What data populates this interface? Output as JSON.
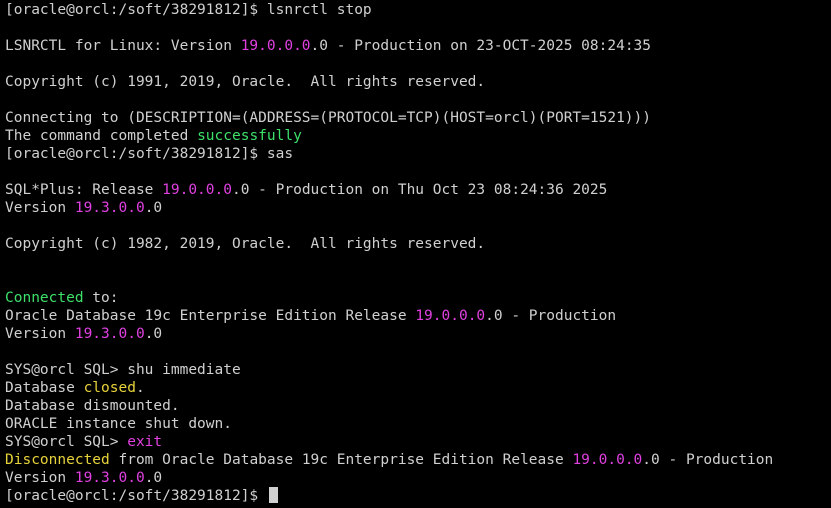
{
  "colors": {
    "background": "#000000",
    "text": "#d0d0d0",
    "version_magenta": "#e040e0",
    "success_green": "#3ee06a",
    "status_yellow": "#e6d23a"
  },
  "lines": [
    {
      "name": "prompt-line",
      "segments": [
        {
          "text": "[oracle@orcl:/soft/38291812]$ lsnrctl stop"
        }
      ]
    },
    {
      "name": "blank-line",
      "segments": []
    },
    {
      "name": "output-line",
      "segments": [
        {
          "text": "LSNRCTL for Linux: Version "
        },
        {
          "text": "19.0.0.0",
          "color": "magenta"
        },
        {
          "text": ".0 - Production on 23-OCT-2025 08:24:35"
        }
      ]
    },
    {
      "name": "blank-line",
      "segments": []
    },
    {
      "name": "output-line",
      "segments": [
        {
          "text": "Copyright (c) 1991, 2019, Oracle.  All rights reserved."
        }
      ]
    },
    {
      "name": "blank-line",
      "segments": []
    },
    {
      "name": "output-line",
      "segments": [
        {
          "text": "Connecting to (DESCRIPTION=(ADDRESS=(PROTOCOL=TCP)(HOST=orcl)(PORT=1521)))"
        }
      ]
    },
    {
      "name": "output-line",
      "segments": [
        {
          "text": "The command completed "
        },
        {
          "text": "successfully",
          "color": "green"
        }
      ]
    },
    {
      "name": "prompt-line",
      "segments": [
        {
          "text": "[oracle@orcl:/soft/38291812]$ sas"
        }
      ]
    },
    {
      "name": "blank-line",
      "segments": []
    },
    {
      "name": "output-line",
      "segments": [
        {
          "text": "SQL*Plus: Release "
        },
        {
          "text": "19.0.0.0",
          "color": "magenta"
        },
        {
          "text": ".0 - Production on Thu Oct 23 08:24:36 2025"
        }
      ]
    },
    {
      "name": "output-line",
      "segments": [
        {
          "text": "Version "
        },
        {
          "text": "19.3.0.0",
          "color": "magenta"
        },
        {
          "text": ".0"
        }
      ]
    },
    {
      "name": "blank-line",
      "segments": []
    },
    {
      "name": "output-line",
      "segments": [
        {
          "text": "Copyright (c) 1982, 2019, Oracle.  All rights reserved."
        }
      ]
    },
    {
      "name": "blank-line",
      "segments": []
    },
    {
      "name": "blank-line",
      "segments": []
    },
    {
      "name": "output-line",
      "segments": [
        {
          "text": "Connected",
          "color": "green"
        },
        {
          "text": " to:"
        }
      ]
    },
    {
      "name": "output-line",
      "segments": [
        {
          "text": "Oracle Database 19c Enterprise Edition Release "
        },
        {
          "text": "19.0.0.0",
          "color": "magenta"
        },
        {
          "text": ".0 - Production"
        }
      ]
    },
    {
      "name": "output-line",
      "segments": [
        {
          "text": "Version "
        },
        {
          "text": "19.3.0.0",
          "color": "magenta"
        },
        {
          "text": ".0"
        }
      ]
    },
    {
      "name": "blank-line",
      "segments": []
    },
    {
      "name": "sql-prompt-line",
      "segments": [
        {
          "text": "SYS@orcl SQL> shu immediate"
        }
      ]
    },
    {
      "name": "output-line",
      "segments": [
        {
          "text": "Database "
        },
        {
          "text": "closed",
          "color": "yellow"
        },
        {
          "text": "."
        }
      ]
    },
    {
      "name": "output-line",
      "segments": [
        {
          "text": "Database dismounted."
        }
      ]
    },
    {
      "name": "output-line",
      "segments": [
        {
          "text": "ORACLE instance shut down."
        }
      ]
    },
    {
      "name": "sql-prompt-line",
      "segments": [
        {
          "text": "SYS@orcl SQL> "
        },
        {
          "text": "exit",
          "color": "magenta"
        }
      ]
    },
    {
      "name": "output-line",
      "segments": [
        {
          "text": "Disconnected",
          "color": "yellow"
        },
        {
          "text": " from Oracle Database 19c Enterprise Edition Release "
        },
        {
          "text": "19.0.0.0",
          "color": "magenta"
        },
        {
          "text": ".0 - Production"
        }
      ]
    },
    {
      "name": "output-line",
      "segments": [
        {
          "text": "Version "
        },
        {
          "text": "19.3.0.0",
          "color": "magenta"
        },
        {
          "text": ".0"
        }
      ]
    },
    {
      "name": "active-prompt-line",
      "segments": [
        {
          "text": "[oracle@orcl:/soft/38291812]$ "
        }
      ],
      "cursor": true
    }
  ]
}
